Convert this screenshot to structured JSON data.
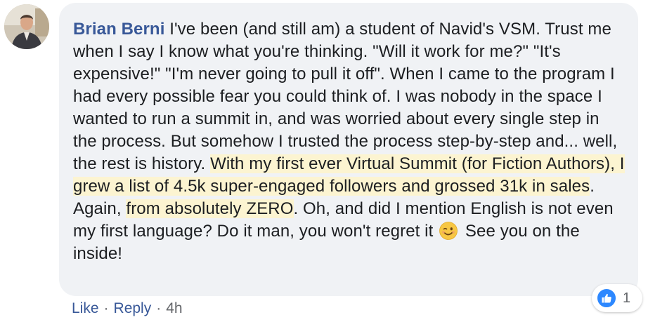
{
  "comment": {
    "author": "Brian Berni",
    "segments": {
      "s1": " I've been (and still am) a student of Navid's VSM. Trust me when I say I know what you're thinking. \"Will it work for me?\" \"It's expensive!\" \"I'm never going to pull it off\". When I came to the program I had every possible fear you could think of. I was nobody in the space I wanted to run a summit in, and was worried about every single step in the process. But somehow I trusted the process step-by-step and... well, the rest is history. ",
      "h1": "With my first ever Virtual Summit (for Fiction Authors), I grew a list of 4.5k super-engaged followers and grossed 31k in sales",
      "s2": ". Again, ",
      "h2": "from absolutely ZERO",
      "s3": ". Oh, and did I mention English is not even my first language? Do it man, you won't regret it ",
      "s4": " See you on the inside!"
    },
    "emoji": "winking-face-emoji"
  },
  "reactions": {
    "icon": "thumbs-up-icon",
    "count": "1",
    "color": "#2d88ff"
  },
  "actions": {
    "like_label": "Like",
    "reply_label": "Reply",
    "separator": "·",
    "time": "4h"
  },
  "colors": {
    "bubble": "#f0f2f5",
    "name": "#385898",
    "highlight": "#fcf4d1",
    "text": "#1c1e21",
    "meta": "#65676b"
  }
}
